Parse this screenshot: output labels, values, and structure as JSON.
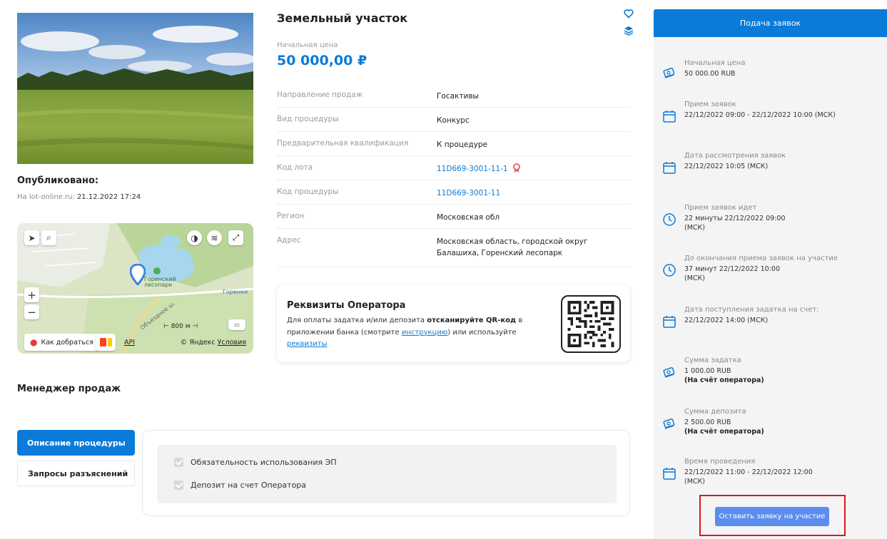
{
  "lot": {
    "title": "Земельный участок",
    "price_label": "Начальная цена",
    "price_value": "50 000,00 ₽"
  },
  "published": {
    "title": "Опубликовано:",
    "site_label": "На lot-online.ru:",
    "date": "21.12.2022 17:24"
  },
  "properties": [
    {
      "key": "Направление продаж",
      "value": "Госактивы"
    },
    {
      "key": "Вид процедуры",
      "value": "Конкурс"
    },
    {
      "key": "Предварительная квалификация",
      "value": "К процедуре"
    },
    {
      "key": "Код лота",
      "value": "11D669-3001-11-1"
    },
    {
      "key": "Код процедуры",
      "value": "11D669-3001-11"
    },
    {
      "key": "Регион",
      "value": "Московская обл"
    },
    {
      "key": "Адрес",
      "value": "Московская область, городской округ Балашиха, Горенский лесопарк"
    }
  ],
  "map": {
    "label_park": "Горенский лесопарк",
    "label_town": "Горенки",
    "label_road": "Объездное ш.",
    "route_label": "Как добраться",
    "api_label": "API",
    "copyright": "© Яндекс",
    "terms": "Условия",
    "scale": "800 м"
  },
  "operator": {
    "title": "Реквизиты Оператора",
    "text_1": "Для оплаты задатка и/или депозита",
    "text_bold": "отсканируйте QR-код",
    "text_2": "в приложении банка (смотрите",
    "link_instruction": "инструкцию",
    "text_3": ") или используйте",
    "link_requisites": "реквизиты"
  },
  "manager": {
    "title": "Менеджер продаж"
  },
  "tabs": {
    "description": "Описание процедуры",
    "questions": "Запросы разъяснений"
  },
  "checkboxes": [
    {
      "label": "Обязательность использования ЭП",
      "checked": true
    },
    {
      "label": "Депозит на счет Оператора",
      "checked": true
    }
  ],
  "sidebar": {
    "header": "Подача заявок",
    "items": [
      {
        "icon": "money-icon",
        "label": "Начальная цена",
        "value": "50 000.00 RUB",
        "note": ""
      },
      {
        "icon": "calendar-icon",
        "label": "Прием заявок",
        "value": "22/12/2022 09:00  - 22/12/2022 10:00 (МСК)",
        "note": ""
      },
      {
        "icon": "calendar-icon",
        "label": "Дата рассмотрения заявок",
        "value": "22/12/2022 10:05 (МСК)",
        "note": ""
      },
      {
        "icon": "clock-icon",
        "label": "Прием заявок идет",
        "value": "22 минуты 22/12/2022 09:00 (МСК)",
        "note": ""
      },
      {
        "icon": "clock-icon",
        "label": "До окончания приема заявок на участие",
        "value": "37 минут 22/12/2022 10:00 (МСК)",
        "note": ""
      },
      {
        "icon": "calendar-icon",
        "label": "Дата поступления задатка на счет:",
        "value": "22/12/2022 14:00 (МСК)",
        "note": ""
      },
      {
        "icon": "money-icon",
        "label": "Сумма задатка",
        "value": "1 000.00 RUB",
        "note": "(На счёт оператора)"
      },
      {
        "icon": "money-icon",
        "label": "Сумма депозита",
        "value": "2 500.00 RUB",
        "note": "(На счёт оператора)"
      },
      {
        "icon": "calendar-icon",
        "label": "Время проведения",
        "value": "22/12/2022 11:00 - 22/12/2022 12:00 (МСК)",
        "note": ""
      }
    ],
    "apply_button": "Оставить заявку на участие"
  },
  "colors": {
    "accent": "#0a7bd8",
    "apply_button": "#5b8def",
    "highlight": "#d9181b",
    "award": "#e85a5a"
  }
}
